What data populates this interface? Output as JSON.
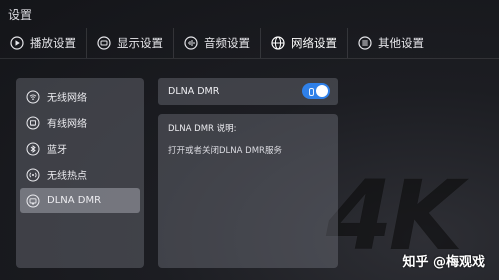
{
  "page": {
    "title": "设置"
  },
  "tabs": [
    {
      "label": "播放设置",
      "icon": "play-icon"
    },
    {
      "label": "显示设置",
      "icon": "display-icon"
    },
    {
      "label": "音频设置",
      "icon": "audio-icon"
    },
    {
      "label": "网络设置",
      "icon": "globe-icon",
      "active": true
    },
    {
      "label": "其他设置",
      "icon": "menu-icon"
    }
  ],
  "sidebar": {
    "items": [
      {
        "label": "无线网络",
        "icon": "wifi-icon"
      },
      {
        "label": "有线网络",
        "icon": "ethernet-icon"
      },
      {
        "label": "蓝牙",
        "icon": "bluetooth-icon"
      },
      {
        "label": "无线热点",
        "icon": "hotspot-icon"
      },
      {
        "label": "DLNA DMR",
        "icon": "dlna-icon",
        "selected": true
      }
    ]
  },
  "dlna": {
    "label": "DLNA DMR",
    "enabled": true
  },
  "description": {
    "title": "DLNA DMR 说明:",
    "text": "打开或者关闭DLNA DMR服务"
  },
  "background_mark": "4K",
  "watermark": "知乎 @梅观戏",
  "colors": {
    "accent": "#2f80e8",
    "panel": "rgba(120,122,132,0.40)",
    "selected": "rgba(190,192,202,0.42)"
  }
}
